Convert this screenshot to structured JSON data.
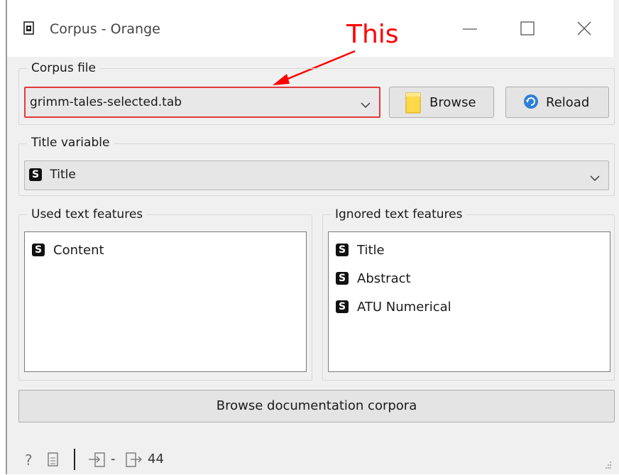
{
  "window": {
    "title": "Corpus - Orange",
    "icon": "document-icon",
    "controls": [
      "minimize-icon",
      "maximize-icon",
      "close-icon"
    ]
  },
  "annotation": {
    "text": "This",
    "color": "#ff0000"
  },
  "corpus_file": {
    "group_label": "Corpus file",
    "selected": "grimm-tales-selected.tab",
    "browse_label": "Browse",
    "reload_label": "Reload",
    "highlight_color": "#e23b3b"
  },
  "title_variable": {
    "group_label": "Title variable",
    "badge": "S",
    "selected": "Title"
  },
  "used_features": {
    "group_label": "Used text features",
    "items": [
      {
        "badge": "S",
        "label": "Content"
      }
    ]
  },
  "ignored_features": {
    "group_label": "Ignored text features",
    "items": [
      {
        "badge": "S",
        "label": "Title"
      },
      {
        "badge": "S",
        "label": "Abstract"
      },
      {
        "badge": "S",
        "label": "ATU Numerical"
      }
    ]
  },
  "browse_docs_label": "Browse documentation corpora",
  "status_bar": {
    "input_value": "-",
    "output_value": "44"
  }
}
